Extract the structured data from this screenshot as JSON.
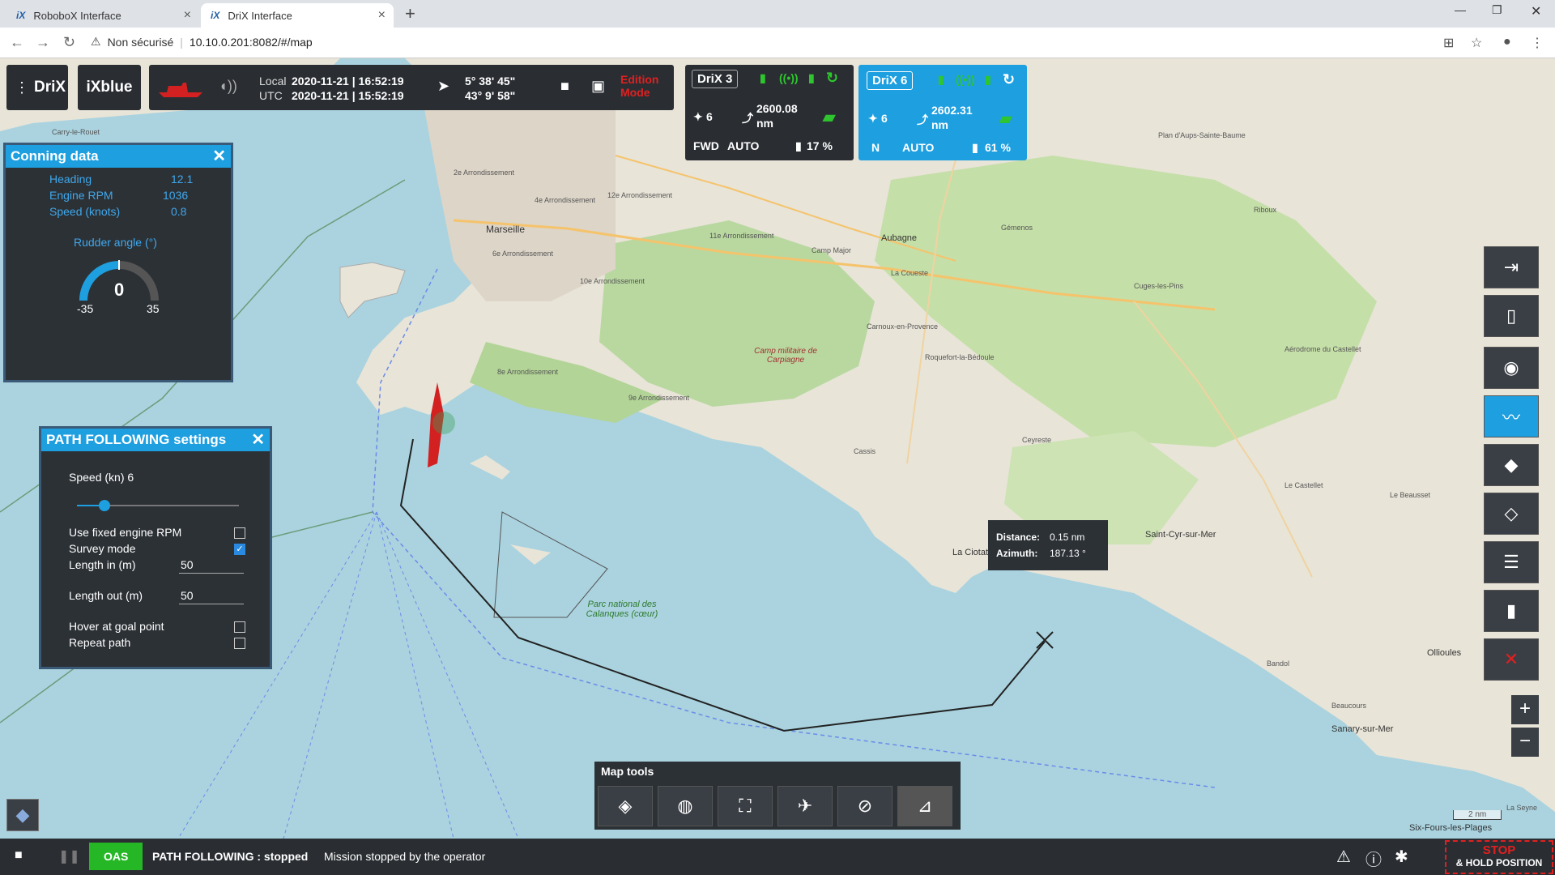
{
  "browser": {
    "tabs": [
      {
        "label": "RoboboX Interface",
        "favicon": "iX"
      },
      {
        "label": "DriX Interface",
        "favicon": "iX"
      }
    ],
    "security_label": "Non sécurisé",
    "url": "10.10.0.201:8082/#/map"
  },
  "topbar": {
    "drix_label": "DriX",
    "ixblue_label": "iXblue",
    "local_label": "Local",
    "local_time": "2020-11-21 | 16:52:19",
    "utc_label": "UTC",
    "utc_time": "2020-11-21 | 15:52:19",
    "lon": "5° 38' 45\"",
    "lat": "43° 9' 58\"",
    "edition_mode": "Edition Mode"
  },
  "drix3": {
    "name": "DriX 3",
    "satellites": "6",
    "distance_value": "2600.08",
    "distance_unit": "nm",
    "gear": "FWD",
    "mode": "AUTO",
    "fuel": "17 %"
  },
  "drix6": {
    "name": "DriX 6",
    "satellites": "6",
    "distance_value": "2602.31",
    "distance_unit": "nm",
    "gear": "N",
    "mode": "AUTO",
    "fuel": "61 %"
  },
  "conning": {
    "title": "Conning data",
    "rows": [
      {
        "label": "Heading",
        "value": "12.1"
      },
      {
        "label": "Engine RPM",
        "value": "1036"
      },
      {
        "label": "Speed (knots)",
        "value": "0.8"
      }
    ],
    "rudder_title": "Rudder angle (°)",
    "rudder_value": "0",
    "rudder_min": "-35",
    "rudder_max": "35"
  },
  "path_following": {
    "title": "PATH FOLLOWING settings",
    "speed_label": "Speed (kn) 6",
    "speed_fraction": 0.17,
    "fixed_rpm_label": "Use fixed engine RPM",
    "survey_label": "Survey mode",
    "length_in_label": "Length in (m)",
    "length_in_value": "50",
    "length_out_label": "Length out (m)",
    "length_out_value": "50",
    "hover_label": "Hover at goal point",
    "repeat_label": "Repeat path"
  },
  "measure": {
    "distance_label": "Distance:",
    "distance_value": "0.15 nm",
    "azimuth_label": "Azimuth:",
    "azimuth_value": "187.13 °"
  },
  "map_labels": {
    "carry": "Carry-le-Rouet",
    "arr2": "2e Arrondissement",
    "arr4": "4e Arrondissement",
    "arr12": "12e Arrondissement",
    "arr11": "11e Arrondissement",
    "arr6": "6e Arrondissement",
    "arr10": "10e Arrondissement",
    "arr8": "8e Arrondissement",
    "arr9": "9e Arrondissement",
    "marseille": "Marseille",
    "aubagne": "Aubagne",
    "coueste": "La Couestе",
    "camp_major": "Camp Major",
    "gemenos": "Gémenos",
    "cuges": "Cuges-les-Pins",
    "carnoux": "Carnoux-en-Provence",
    "roquefort": "Roquefort-la-Bédoule",
    "cassis": "Cassis",
    "ceyreste": "Ceyreste",
    "laciotat": "La Ciotat",
    "stcyr": "Saint-Cyr-sur-Mer",
    "lecastellet": "Le Castellet",
    "lebeausset": "Le Beausset",
    "bandol": "Bandol",
    "ollioules": "Ollioules",
    "sanary": "Sanary-sur-Mer",
    "beaucours": "Beaucours",
    "sixfours": "Six-Fours-les-Plages",
    "laseyne": "La Seyne",
    "ribou": "Riboux",
    "plan_aups": "Plan d'Aups-Sainte-Baume",
    "aeropord": "Aérodrome du Castellet",
    "camp_militaire": "Camp militaire de Carpiagne",
    "parc": "Parc national des Calanques (cœur)",
    "scale": "2 nm"
  },
  "map_tools": {
    "title": "Map tools",
    "buttons": [
      "layers-icon",
      "globe-icon",
      "fullscreen-icon",
      "vessel-icon",
      "layers-off-icon",
      "ruler-icon"
    ]
  },
  "right_tools": [
    "import-icon",
    "json-file-icon",
    "target-icon",
    "path-icon",
    "label-icon",
    "label-outline-icon",
    "list-icon",
    "trash-icon",
    "close-icon"
  ],
  "status": {
    "oas": "OAS",
    "path_state": "PATH FOLLOWING : stopped",
    "message": "Mission stopped by the operator",
    "stop_label": "STOP",
    "hold_label": "& HOLD POSITION"
  },
  "colors": {
    "accent": "#1d9fe0",
    "panel": "#2c3136",
    "alert": "#e02020",
    "ok": "#26b726",
    "sea": "#aad3df"
  }
}
